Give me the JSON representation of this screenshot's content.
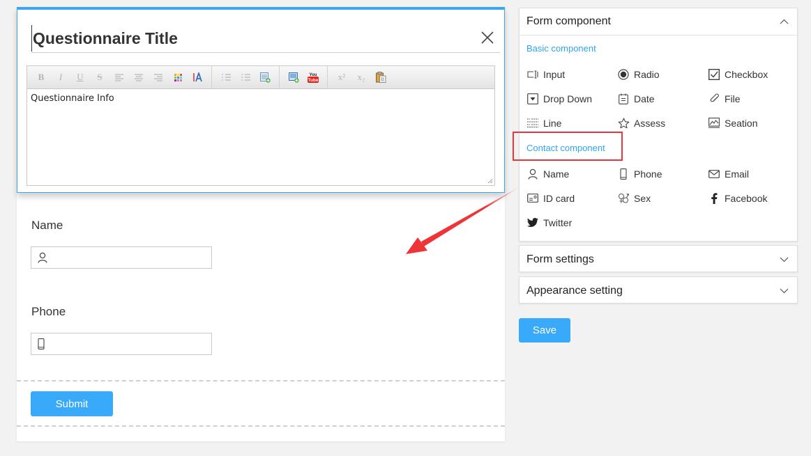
{
  "header": {
    "title_value": "Questionnaire Title",
    "close_icon": "close-icon"
  },
  "editor": {
    "toolbar_groups": [
      [
        "bold",
        "italic",
        "underline",
        "strikethrough",
        "align-left",
        "align-center",
        "align-right",
        "color-palette",
        "text-format"
      ],
      [
        "ordered-list",
        "unordered-list",
        "insert-table"
      ],
      [
        "insert-image",
        "insert-youtube"
      ],
      [
        "superscript",
        "subscript",
        "paste"
      ]
    ],
    "labels": {
      "bold": "B",
      "italic": "I",
      "underline": "U",
      "strikethrough": "S",
      "superscript": "x²",
      "subscript": "x₂",
      "youtube_top": "You",
      "youtube_bottom": "Tube"
    },
    "content": "Questionnaire Info"
  },
  "form": {
    "fields": [
      {
        "label": "Name",
        "icon": "person-icon",
        "value": ""
      },
      {
        "label": "Phone",
        "icon": "phone-icon",
        "value": ""
      }
    ],
    "submit_label": "Submit"
  },
  "sidebar": {
    "form_component": {
      "title": "Form component",
      "expanded": true,
      "basic_title": "Basic component",
      "basic_items": [
        {
          "label": "Input",
          "icon": "input-icon"
        },
        {
          "label": "Radio",
          "icon": "radio-icon"
        },
        {
          "label": "Checkbox",
          "icon": "checkbox-icon"
        },
        {
          "label": "Drop Down",
          "icon": "dropdown-icon"
        },
        {
          "label": "Date",
          "icon": "date-icon"
        },
        {
          "label": "File",
          "icon": "paperclip-icon"
        },
        {
          "label": "Line",
          "icon": "line-icon"
        },
        {
          "label": "Assess",
          "icon": "star-icon"
        },
        {
          "label": "Seation",
          "icon": "image-icon"
        }
      ],
      "contact_title": "Contact component",
      "contact_items": [
        {
          "label": "Name",
          "icon": "person-icon"
        },
        {
          "label": "Phone",
          "icon": "phone-icon"
        },
        {
          "label": "Email",
          "icon": "envelope-icon"
        },
        {
          "label": "ID card",
          "icon": "id-card-icon"
        },
        {
          "label": "Sex",
          "icon": "gender-icon"
        },
        {
          "label": "Facebook",
          "icon": "facebook-icon"
        },
        {
          "label": "Twitter",
          "icon": "twitter-icon"
        }
      ]
    },
    "form_settings": {
      "title": "Form settings",
      "expanded": false
    },
    "appearance_setting": {
      "title": "Appearance setting",
      "expanded": false
    },
    "save_label": "Save"
  },
  "colors": {
    "accent": "#39aaf9",
    "annotation": "#ee3437",
    "background": "#f2f2f2"
  }
}
